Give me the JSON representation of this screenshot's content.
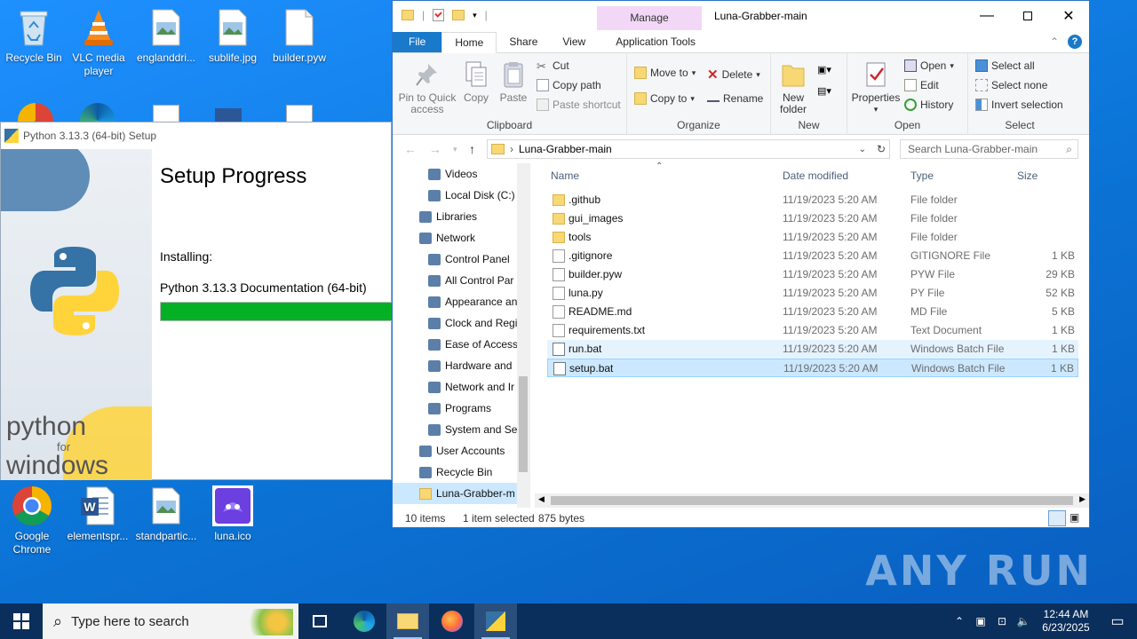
{
  "desktop": {
    "icons_top": [
      {
        "label": "Recycle Bin"
      },
      {
        "label": "VLC media player"
      },
      {
        "label": "englanddri..."
      },
      {
        "label": "sublife.jpg"
      },
      {
        "label": "builder.pyw"
      }
    ],
    "icons_bottom": [
      {
        "label": "Google Chrome"
      },
      {
        "label": "elementspr..."
      },
      {
        "label": "standpartic..."
      },
      {
        "label": "luna.ico"
      }
    ],
    "watermark": "ANY RUN"
  },
  "python_setup": {
    "title": "Python 3.13.3 (64-bit) Setup",
    "heading": "Setup Progress",
    "installing_label": "Installing:",
    "current_item": "Python 3.13.3 Documentation (64-bit)",
    "progress": 1.0,
    "logo_text_1": "python",
    "logo_text_2": "for",
    "logo_text_3": "windows"
  },
  "explorer": {
    "context_tab": "Manage",
    "title": "Luna-Grabber-main",
    "tabs": [
      "File",
      "Home",
      "Share",
      "View",
      "Application Tools"
    ],
    "ribbon": {
      "clipboard": {
        "label": "Clipboard",
        "pin": "Pin to Quick access",
        "copy": "Copy",
        "paste": "Paste",
        "cut": "Cut",
        "copy_path": "Copy path",
        "paste_shortcut": "Paste shortcut"
      },
      "organize": {
        "label": "Organize",
        "move_to": "Move to",
        "copy_to": "Copy to",
        "delete": "Delete",
        "rename": "Rename"
      },
      "new": {
        "label": "New",
        "new_folder": "New folder"
      },
      "open": {
        "label": "Open",
        "properties": "Properties",
        "open": "Open",
        "edit": "Edit",
        "history": "History"
      },
      "select": {
        "label": "Select",
        "select_all": "Select all",
        "select_none": "Select none",
        "invert": "Invert selection"
      }
    },
    "address": "Luna-Grabber-main",
    "search_placeholder": "Search Luna-Grabber-main",
    "nav": [
      {
        "label": "Videos"
      },
      {
        "label": "Local Disk (C:)"
      },
      {
        "label": "Libraries"
      },
      {
        "label": "Network"
      },
      {
        "label": "Control Panel"
      },
      {
        "label": "All Control Par"
      },
      {
        "label": "Appearance an"
      },
      {
        "label": "Clock and Regi"
      },
      {
        "label": "Ease of Access"
      },
      {
        "label": "Hardware and"
      },
      {
        "label": "Network and Ir"
      },
      {
        "label": "Programs"
      },
      {
        "label": "System and Se"
      },
      {
        "label": "User Accounts"
      },
      {
        "label": "Recycle Bin"
      },
      {
        "label": "Luna-Grabber-m"
      }
    ],
    "columns": {
      "name": "Name",
      "date": "Date modified",
      "type": "Type",
      "size": "Size"
    },
    "files": [
      {
        "name": ".github",
        "date": "11/19/2023 5:20 AM",
        "type": "File folder",
        "size": "",
        "kind": "folder"
      },
      {
        "name": "gui_images",
        "date": "11/19/2023 5:20 AM",
        "type": "File folder",
        "size": "",
        "kind": "folder"
      },
      {
        "name": "tools",
        "date": "11/19/2023 5:20 AM",
        "type": "File folder",
        "size": "",
        "kind": "folder"
      },
      {
        "name": ".gitignore",
        "date": "11/19/2023 5:20 AM",
        "type": "GITIGNORE File",
        "size": "1 KB",
        "kind": "file"
      },
      {
        "name": "builder.pyw",
        "date": "11/19/2023 5:20 AM",
        "type": "PYW File",
        "size": "29 KB",
        "kind": "file"
      },
      {
        "name": "luna.py",
        "date": "11/19/2023 5:20 AM",
        "type": "PY File",
        "size": "52 KB",
        "kind": "file"
      },
      {
        "name": "README.md",
        "date": "11/19/2023 5:20 AM",
        "type": "MD File",
        "size": "5 KB",
        "kind": "file"
      },
      {
        "name": "requirements.txt",
        "date": "11/19/2023 5:20 AM",
        "type": "Text Document",
        "size": "1 KB",
        "kind": "file"
      },
      {
        "name": "run.bat",
        "date": "11/19/2023 5:20 AM",
        "type": "Windows Batch File",
        "size": "1 KB",
        "kind": "bat"
      },
      {
        "name": "setup.bat",
        "date": "11/19/2023 5:20 AM",
        "type": "Windows Batch File",
        "size": "1 KB",
        "kind": "bat"
      }
    ],
    "status": {
      "count": "10 items",
      "selected": "1 item selected",
      "bytes": "875 bytes"
    }
  },
  "taskbar": {
    "search_placeholder": "Type here to search",
    "time": "12:44 AM",
    "date": "6/23/2025"
  },
  "colors": {
    "accent": "#1979ca",
    "progress": "#06b025",
    "selection": "#cce8ff",
    "taskbar": "#0b2f5c"
  }
}
